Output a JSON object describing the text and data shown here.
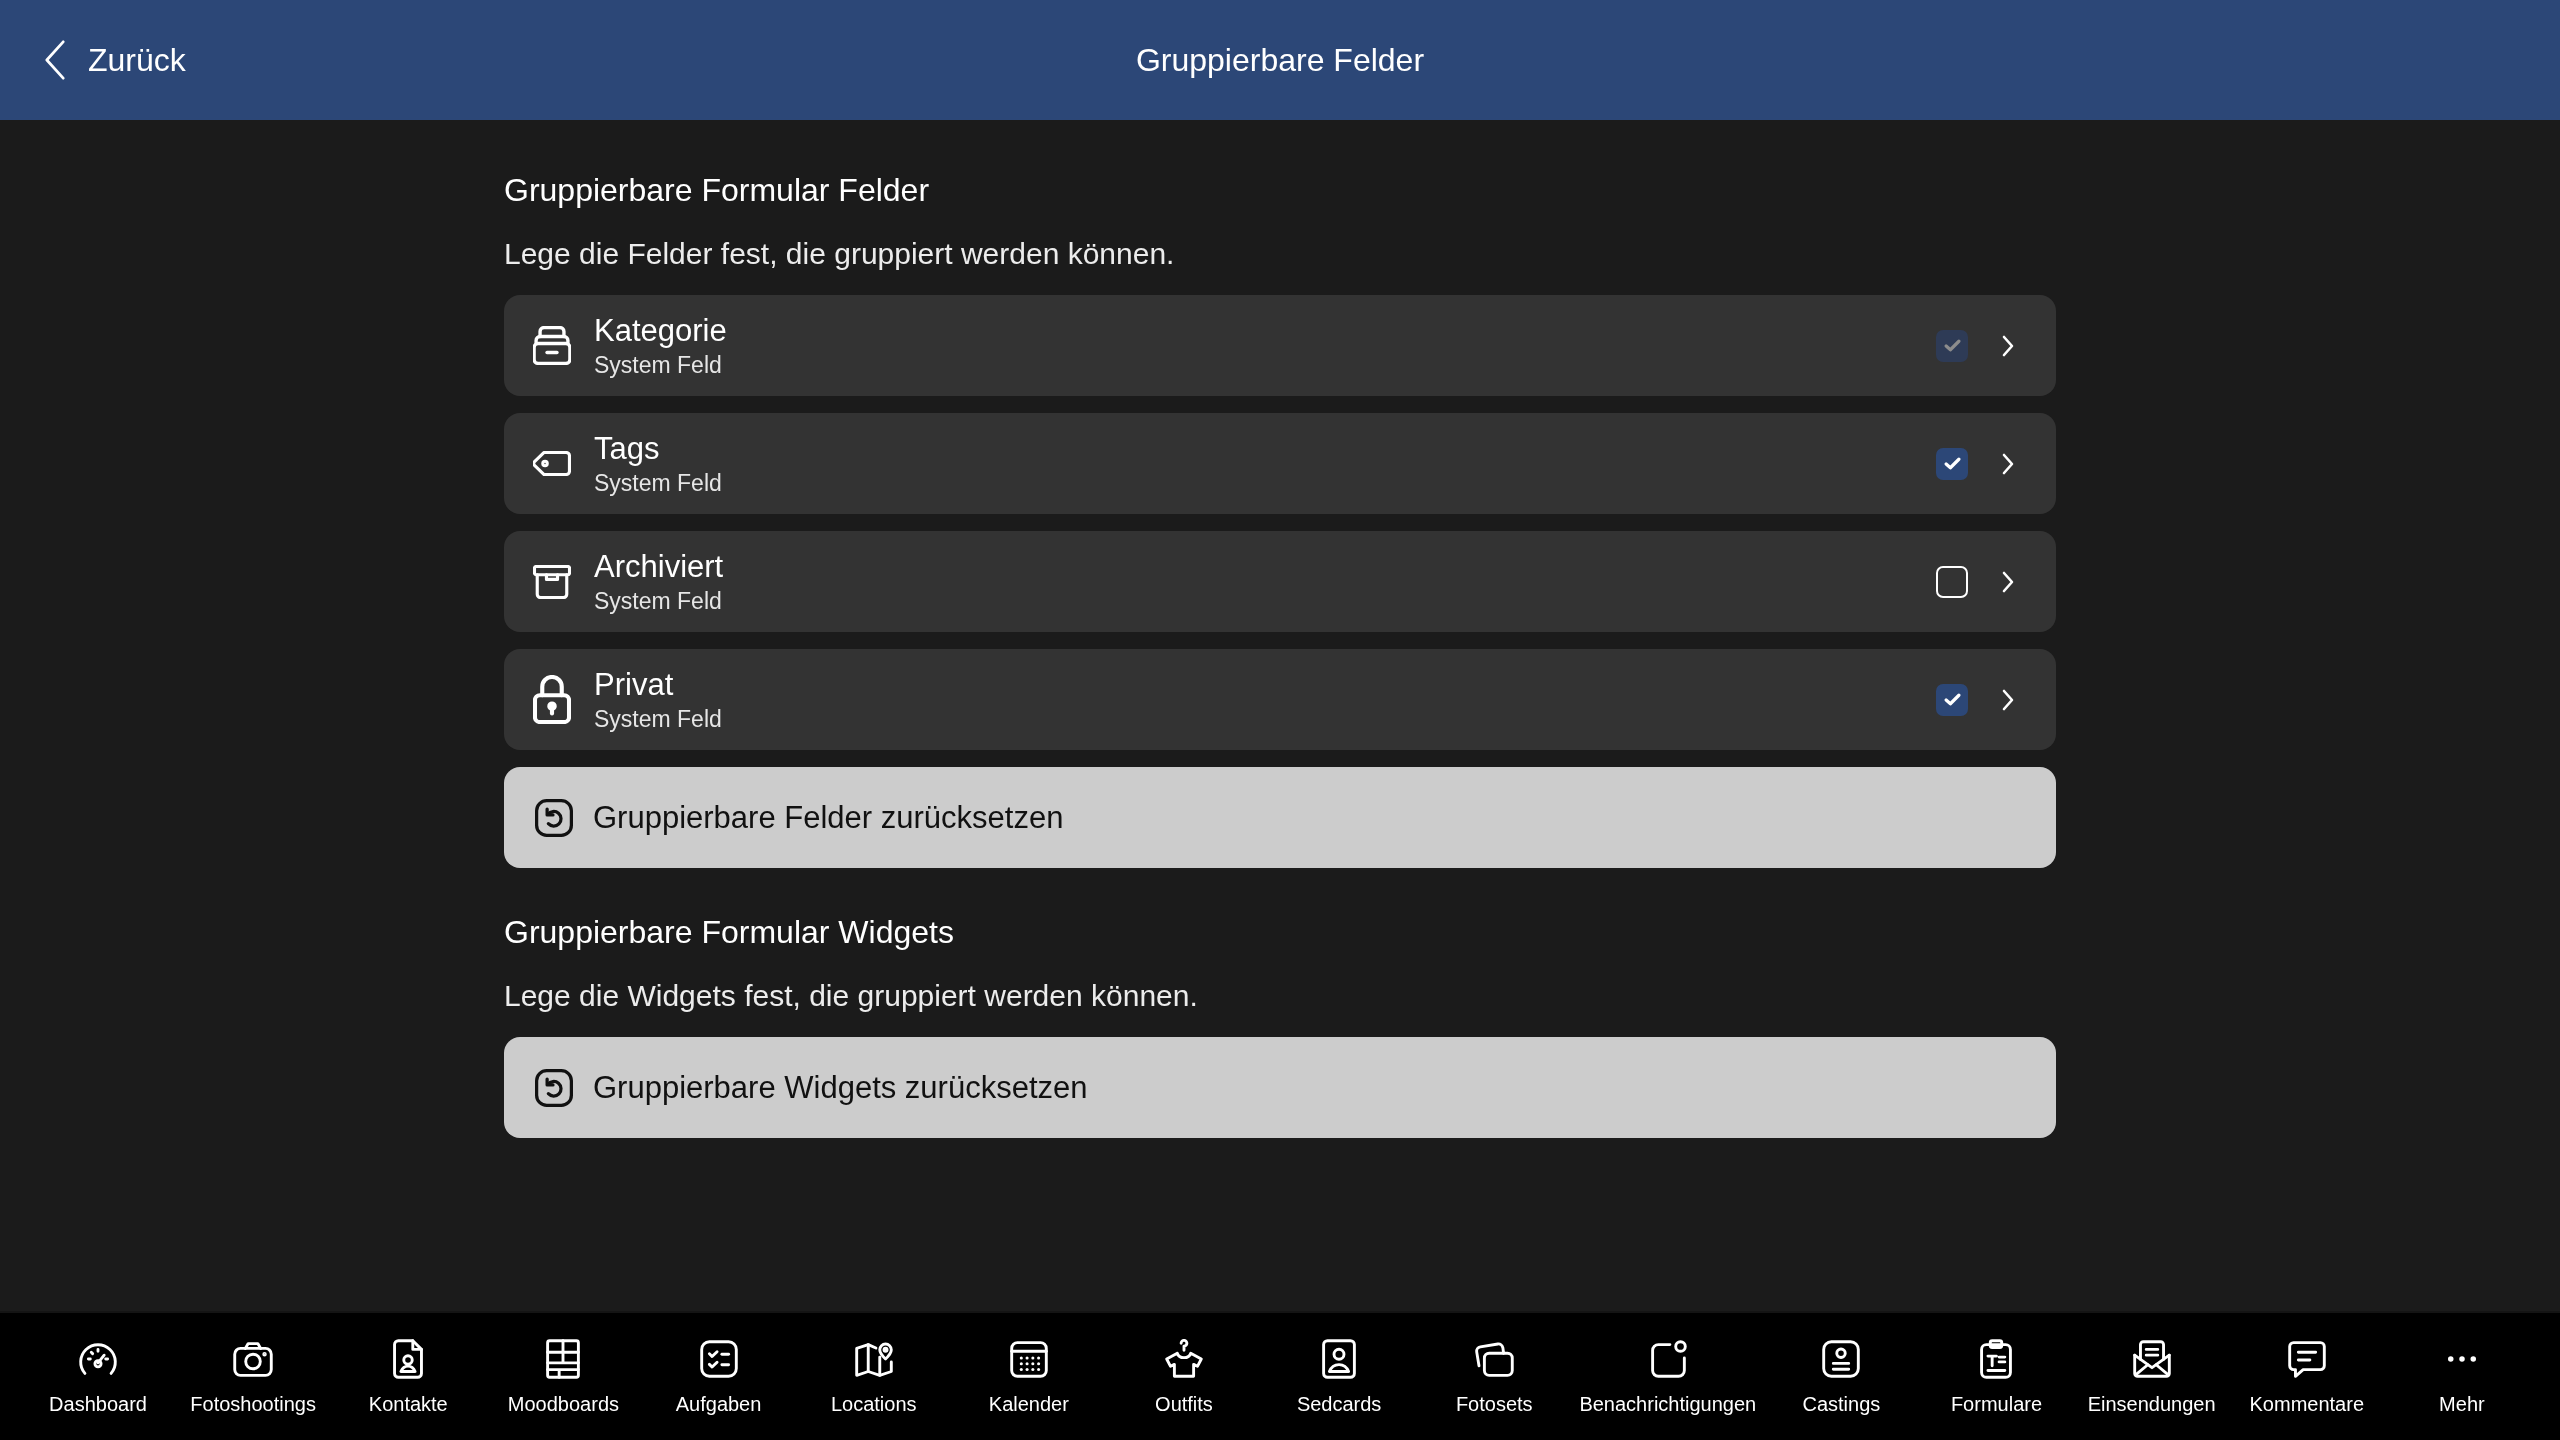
{
  "header": {
    "back_label": "Zurück",
    "title": "Gruppierbare Felder"
  },
  "sections": [
    {
      "title": "Gruppierbare Formular Felder",
      "description": "Lege die Felder fest, die gruppiert werden können.",
      "fields": [
        {
          "name": "Kategorie",
          "subtitle": "System Feld",
          "checked": true,
          "disabled": true
        },
        {
          "name": "Tags",
          "subtitle": "System Feld",
          "checked": true,
          "disabled": false
        },
        {
          "name": "Archiviert",
          "subtitle": "System Feld",
          "checked": false,
          "disabled": false
        },
        {
          "name": "Privat",
          "subtitle": "System Feld",
          "checked": true,
          "disabled": false
        }
      ],
      "reset_button": "Gruppierbare Felder zurücksetzen"
    },
    {
      "title": "Gruppierbare Formular Widgets",
      "description": "Lege die Widgets fest, die gruppiert werden können.",
      "reset_button": "Gruppierbare Widgets zurücksetzen"
    }
  ],
  "tab_bar": {
    "items": [
      "Dashboard",
      "Fotoshootings",
      "Kontakte",
      "Moodboards",
      "Aufgaben",
      "Locations",
      "Kalender",
      "Outfits",
      "Sedcards",
      "Fotosets",
      "Benachrichtigungen",
      "Castings",
      "Formulare",
      "Einsendungen",
      "Kommentare",
      "Mehr"
    ]
  }
}
